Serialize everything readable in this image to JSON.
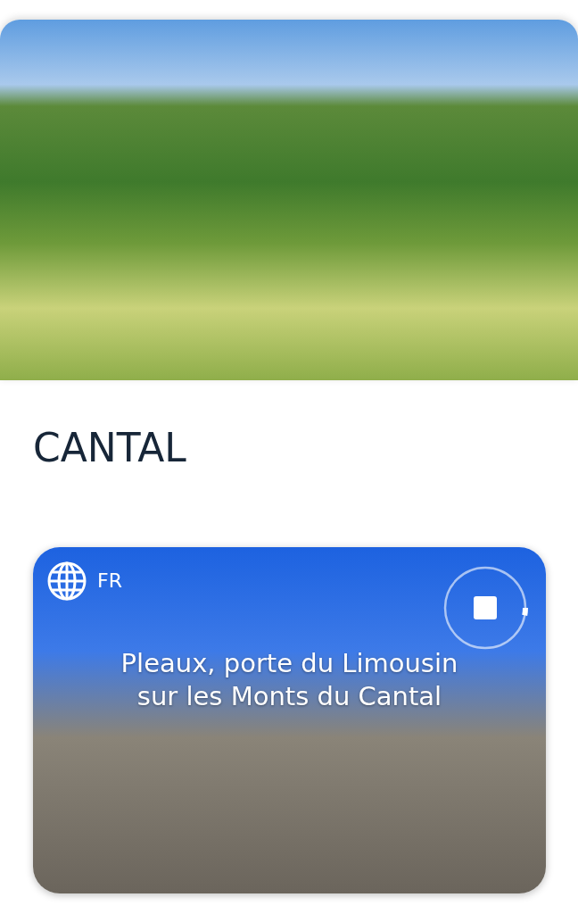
{
  "heading": "CANTAL",
  "card": {
    "language": "FR",
    "title": "Pleaux, porte du Limousin sur les Monts du Cantal",
    "playback": {
      "playing": true,
      "level": 0.03
    }
  }
}
